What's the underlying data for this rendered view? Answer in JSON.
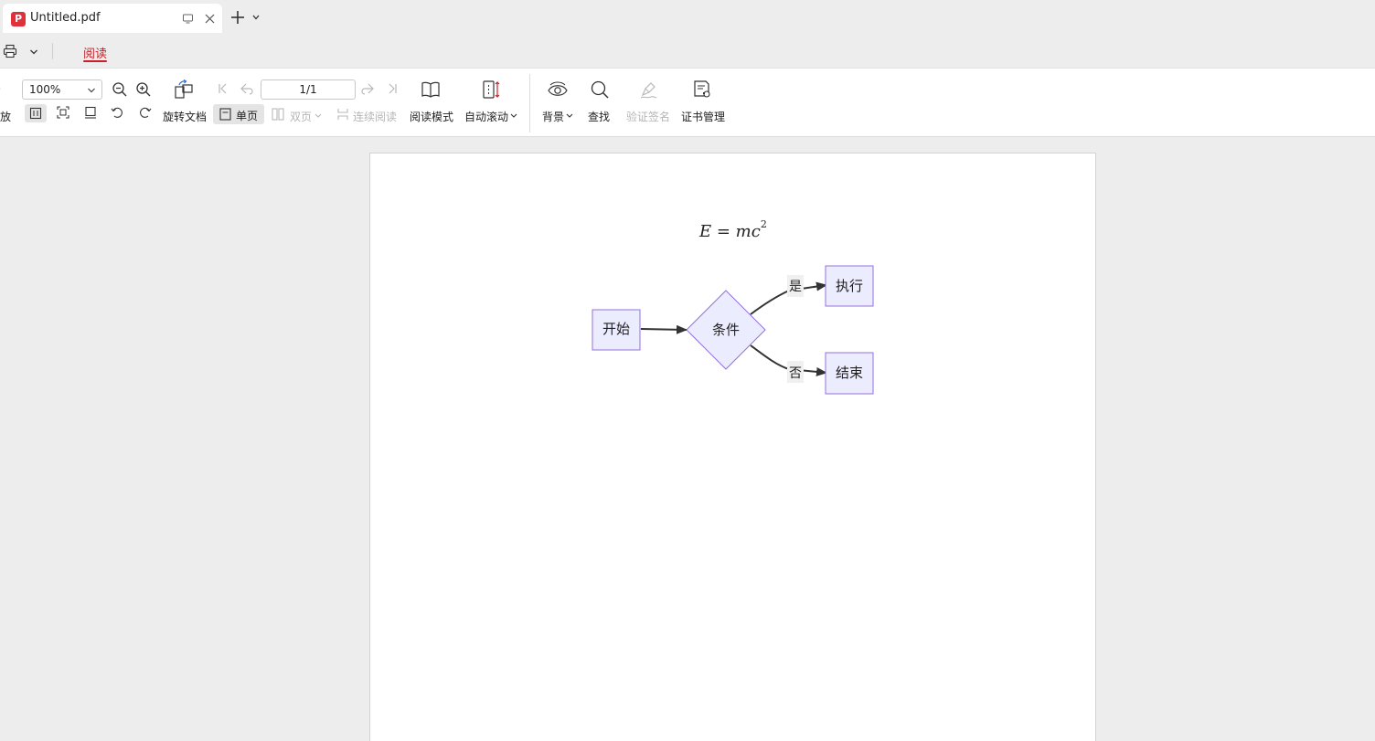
{
  "tab": {
    "title": "Untitled.pdf",
    "app_icon_glyph": "P"
  },
  "ribbon": {
    "active_tab": "阅读",
    "accent_color": "#c8202a"
  },
  "toolbar": {
    "cut_label": "放",
    "zoom_value": "100%",
    "page_value": "1/1",
    "rotate_doc": "旋转文档",
    "single_page": "单页",
    "double_page": "双页",
    "continuous": "连续阅读",
    "read_mode": "阅读模式",
    "auto_scroll": "自动滚动",
    "background": "背景",
    "find": "查找",
    "verify_sign": "验证签名",
    "cert_manage": "证书管理"
  },
  "document": {
    "formula": {
      "E": "E",
      "eq": " = ",
      "m": "m",
      "c": "c",
      "exp": "2"
    },
    "flowchart": {
      "start": "开始",
      "condition": "条件",
      "execute": "执行",
      "end": "结束",
      "yes": "是",
      "no": "否",
      "node_fill": "#ececff",
      "node_stroke": "#9370db"
    }
  },
  "icons": [
    "app-icon",
    "monitor-icon",
    "close-icon",
    "plus-icon",
    "chevron-down-icon",
    "print-icon",
    "zoom-out-icon",
    "zoom-in-icon",
    "rotate-document-icon",
    "first-page-icon",
    "prev-page-icon",
    "next-page-icon",
    "last-page-icon",
    "book-icon",
    "auto-scroll-icon",
    "eye-icon",
    "search-icon",
    "signature-pen-icon",
    "certificate-icon",
    "fit-page-icon",
    "fit-width-icon",
    "actual-size-icon",
    "rotate-left-icon",
    "rotate-right-icon",
    "single-page-icon",
    "double-page-icon",
    "continuous-icon"
  ]
}
